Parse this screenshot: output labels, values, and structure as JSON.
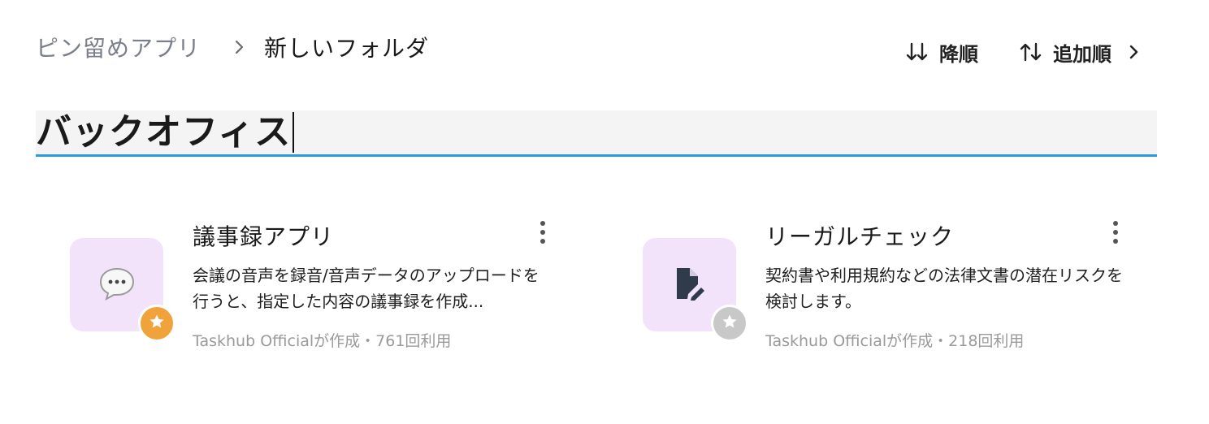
{
  "breadcrumb": {
    "parent": "ピン留めアプリ",
    "separator": "›",
    "current": "新しいフォルダ"
  },
  "sort": {
    "order_label": "降順",
    "order_icon": "sort-down-icon",
    "by_label": "追加順",
    "by_icon": "swap-vertical-icon",
    "next_icon": "chevron-right-icon"
  },
  "folder": {
    "title": "バックオフィス"
  },
  "cards": [
    {
      "title": "議事録アプリ",
      "desc": "会議の音声を録音/音声データのアップロードを行うと、指定した内容の議事録を作成...",
      "meta": "Taskhub Officialが作成・761回利用",
      "icon": "speech-bubble-icon",
      "pinned": true,
      "pin_color": "#f0a23b"
    },
    {
      "title": "リーガルチェック",
      "desc": "契約書や利用規約などの法律文書の潜在リスクを検討します。",
      "meta": "Taskhub Officialが作成・218回利用",
      "icon": "document-edit-icon",
      "pinned": false,
      "pin_color": "#c8c8c8"
    }
  ],
  "colors": {
    "accent": "#2b9be0",
    "card_icon_bg": "#f2e3fb",
    "meta_text": "#9a9a9a"
  }
}
